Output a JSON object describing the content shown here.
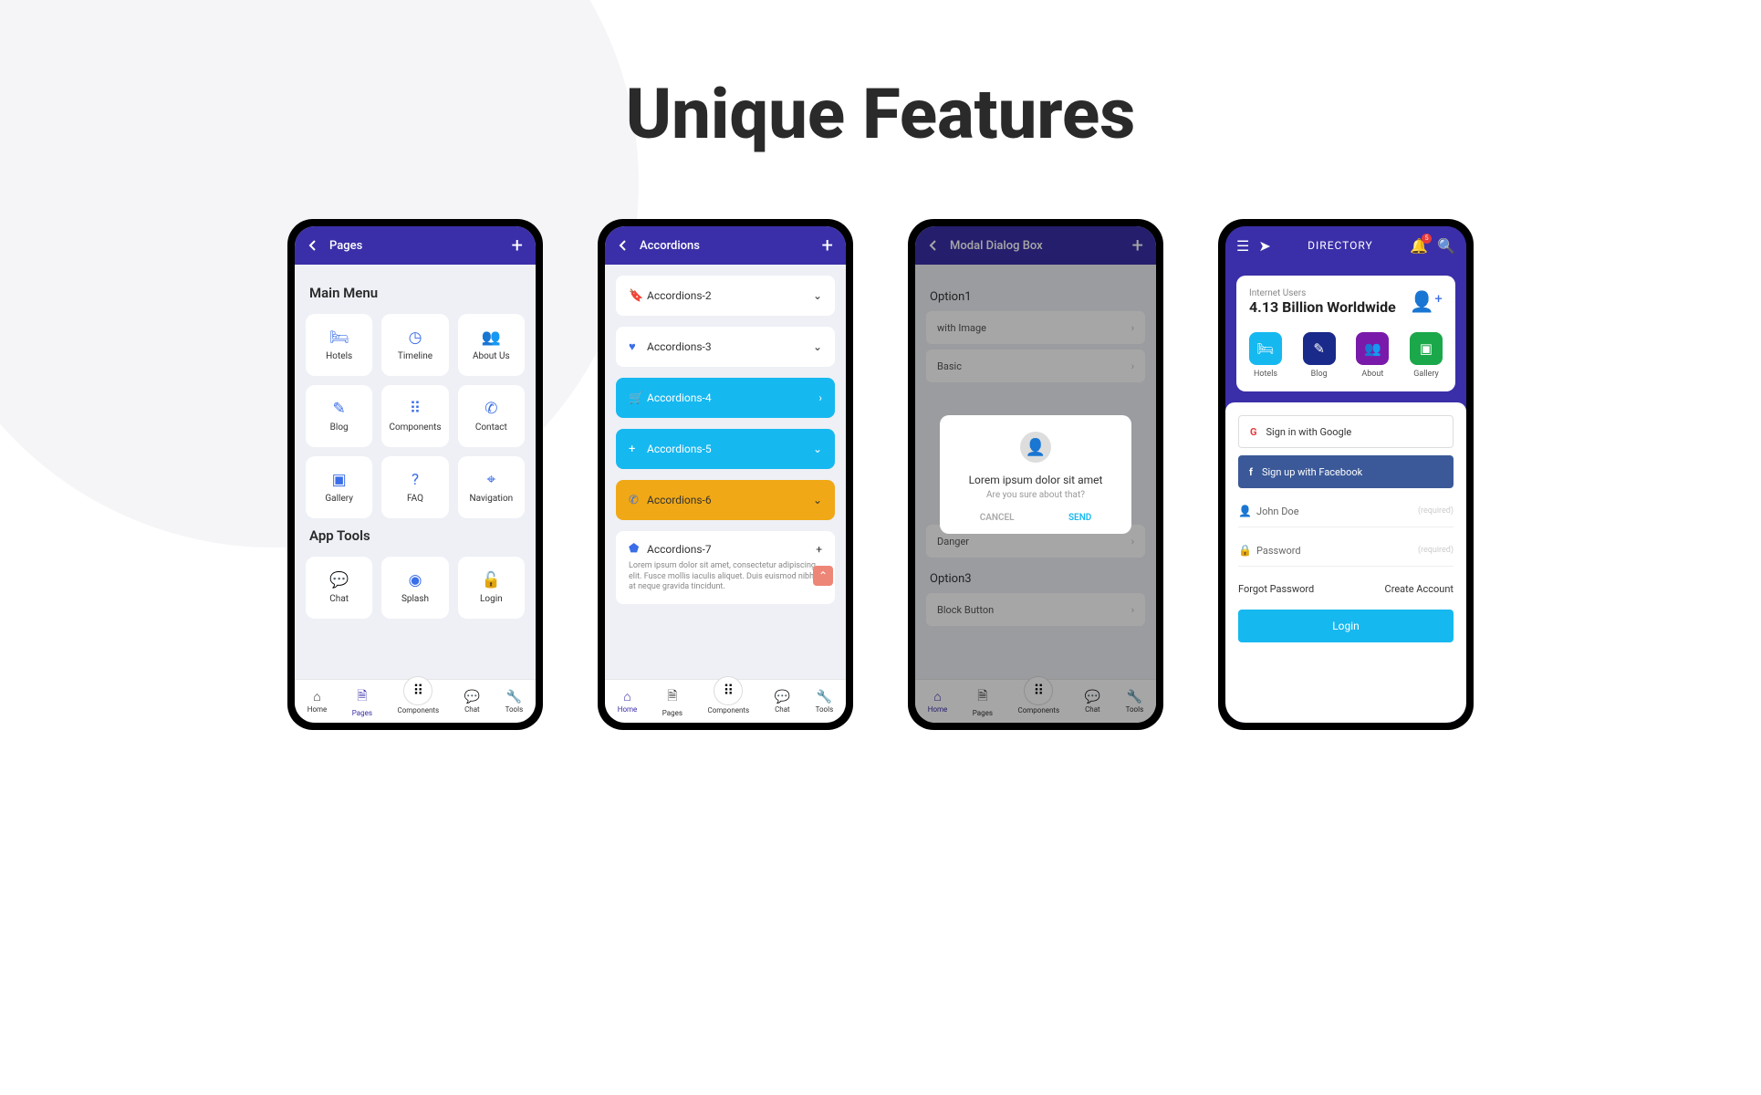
{
  "page_heading": "Unique Features",
  "phone1": {
    "header_title": "Pages",
    "section_main": "Main Menu",
    "section_tools": "App Tools",
    "tiles": [
      {
        "label": "Hotels"
      },
      {
        "label": "Timeline"
      },
      {
        "label": "About Us"
      },
      {
        "label": "Blog"
      },
      {
        "label": "Components"
      },
      {
        "label": "Contact"
      },
      {
        "label": "Gallery"
      },
      {
        "label": "FAQ"
      },
      {
        "label": "Navigation"
      }
    ],
    "tools": [
      {
        "label": "Chat"
      },
      {
        "label": "Splash"
      },
      {
        "label": "Login"
      }
    ]
  },
  "phone2": {
    "header_title": "Accordions",
    "items": [
      {
        "label": "Accordions-2",
        "style": "default"
      },
      {
        "label": "Accordions-3",
        "style": "default"
      },
      {
        "label": "Accordions-4",
        "style": "primary"
      },
      {
        "label": "Accordions-5",
        "style": "primary"
      },
      {
        "label": "Accordions-6",
        "style": "warning"
      },
      {
        "label": "Accordions-7",
        "style": "default",
        "expanded": true,
        "content": "Lorem ipsum dolor sit amet, consectetur adipiscing elit. Fusce mollis iaculis aliquet. Duis euismod nibh at neque gravida tincidunt."
      }
    ]
  },
  "phone3": {
    "header_title": "Modal Dialog Box",
    "option1_label": "Option1",
    "option1_rows": [
      "with Image",
      "Basic"
    ],
    "option3_label": "Option3",
    "option3_rows": [
      "Danger",
      "Block Button"
    ],
    "modal": {
      "title": "Lorem ipsum dolor sit amet",
      "subtitle": "Are you sure about that?",
      "cancel": "CANCEL",
      "send": "SEND"
    }
  },
  "phone4": {
    "header_title": "DIRECTORY",
    "badge": "5",
    "stat_label": "Internet Users",
    "stat_value": "4.13 Billion Worldwide",
    "quick": [
      {
        "label": "Hotels",
        "color": "#16b8f0"
      },
      {
        "label": "Blog",
        "color": "#1a2a8a"
      },
      {
        "label": "About",
        "color": "#7a1aaa"
      },
      {
        "label": "Gallery",
        "color": "#1aa84a"
      }
    ],
    "google": "Sign in with Google",
    "facebook": "Sign up with Facebook",
    "name_value": "John Doe",
    "password_placeholder": "Password",
    "required": "(required)",
    "forgot": "Forgot Password",
    "create": "Create Account",
    "login": "Login"
  },
  "bottom_nav": [
    {
      "label": "Home"
    },
    {
      "label": "Pages"
    },
    {
      "label": "Components"
    },
    {
      "label": "Chat"
    },
    {
      "label": "Tools"
    }
  ]
}
